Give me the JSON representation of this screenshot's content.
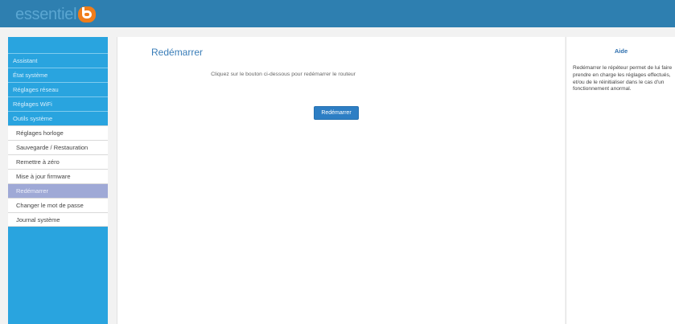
{
  "header": {
    "logo_text": "essentiel",
    "logo_badge": "b",
    "bar_color": "#2e7fb0",
    "logo_accent": "#f07d1a"
  },
  "sidebar": {
    "items": [
      {
        "label": "Assistant"
      },
      {
        "label": "État système"
      },
      {
        "label": "Réglages réseau"
      },
      {
        "label": "Réglages WiFi"
      },
      {
        "label": "Outils système"
      }
    ],
    "sub_items": [
      {
        "label": "Réglages horloge"
      },
      {
        "label": "Sauvegarde / Restauration"
      },
      {
        "label": "Remettre à zéro"
      },
      {
        "label": "Mise à jour firmware"
      },
      {
        "label": "Redémarrer",
        "selected": true
      },
      {
        "label": "Changer le mot de passe"
      },
      {
        "label": "Journal système"
      }
    ]
  },
  "main": {
    "title": "Redémarrer",
    "instruction": "Cliquez sur le bouton ci-dessous pour redémarrer le routeur",
    "button_label": "Redémarrer"
  },
  "help": {
    "title": "Aide",
    "text": "Redémarrer le répéteur permet de lui faire prendre en charge les réglages effectués, et/ou de le réinitialiser dans le cas d'un fonctionnement anormal."
  }
}
